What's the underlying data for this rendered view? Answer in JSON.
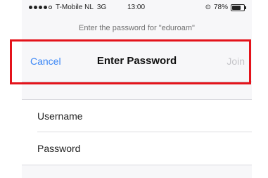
{
  "status_bar": {
    "carrier": "T-Mobile NL",
    "network": "3G",
    "time": "13:00",
    "battery_percent": "78%",
    "battery_level": 0.78,
    "signal_bars_filled": 4,
    "signal_bars_total": 5
  },
  "prompt": "Enter the password for \"eduroam\"",
  "nav": {
    "cancel_label": "Cancel",
    "title": "Enter Password",
    "join_label": "Join"
  },
  "form": {
    "username_placeholder": "Username",
    "password_placeholder": "Password"
  },
  "colors": {
    "accent": "#3a86f6",
    "disabled": "#c4c4c8",
    "highlight": "#e4131b"
  }
}
